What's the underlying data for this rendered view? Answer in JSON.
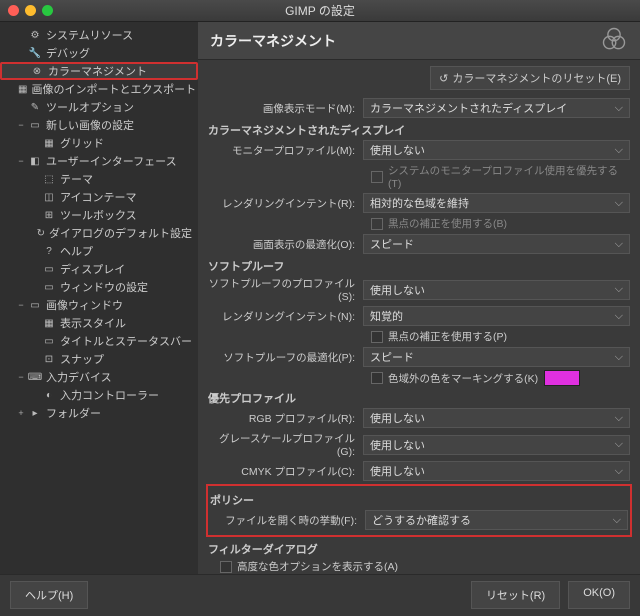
{
  "window": {
    "title": "GIMP の設定"
  },
  "sidebar": {
    "items": [
      {
        "label": "システムリソース",
        "depth": 1,
        "icon": "⚙"
      },
      {
        "label": "デバッグ",
        "depth": 1,
        "icon": "🔧"
      },
      {
        "label": "カラーマネジメント",
        "depth": 1,
        "icon": "⊗",
        "selected": true,
        "highlight": true
      },
      {
        "label": "画像のインポートとエクスポート",
        "depth": 1,
        "icon": "▦"
      },
      {
        "label": "ツールオプション",
        "depth": 1,
        "icon": "✎"
      },
      {
        "label": "新しい画像の設定",
        "depth": 1,
        "icon": "▭",
        "exp": "−"
      },
      {
        "label": "グリッド",
        "depth": 2,
        "icon": "▦"
      },
      {
        "label": "ユーザーインターフェース",
        "depth": 1,
        "icon": "◧",
        "exp": "−"
      },
      {
        "label": "テーマ",
        "depth": 2,
        "icon": "⬚"
      },
      {
        "label": "アイコンテーマ",
        "depth": 2,
        "icon": "◫"
      },
      {
        "label": "ツールボックス",
        "depth": 2,
        "icon": "⊞"
      },
      {
        "label": "ダイアログのデフォルト設定",
        "depth": 2,
        "icon": "↻"
      },
      {
        "label": "ヘルプ",
        "depth": 2,
        "icon": "?"
      },
      {
        "label": "ディスプレイ",
        "depth": 2,
        "icon": "▭"
      },
      {
        "label": "ウィンドウの設定",
        "depth": 2,
        "icon": "▭"
      },
      {
        "label": "画像ウィンドウ",
        "depth": 1,
        "icon": "▭",
        "exp": "−"
      },
      {
        "label": "表示スタイル",
        "depth": 2,
        "icon": "▦"
      },
      {
        "label": "タイトルとステータスバー",
        "depth": 2,
        "icon": "▭"
      },
      {
        "label": "スナップ",
        "depth": 2,
        "icon": "⊡"
      },
      {
        "label": "入力デバイス",
        "depth": 1,
        "icon": "⌨",
        "exp": "−"
      },
      {
        "label": "入力コントローラー",
        "depth": 2,
        "icon": "◐"
      },
      {
        "label": "フォルダー",
        "depth": 1,
        "icon": "▸",
        "exp": "+"
      }
    ]
  },
  "header": {
    "title": "カラーマネジメント"
  },
  "reset": {
    "label": "カラーマネジメントのリセット(E)"
  },
  "form": {
    "mode_lbl": "画像表示モード(M):",
    "mode_val": "カラーマネジメントされたディスプレイ",
    "grp_display": "カラーマネジメントされたディスプレイ",
    "monitor_lbl": "モニタープロファイル(M):",
    "monitor_val": "使用しない",
    "monitor_chk": "システムのモニタープロファイル使用を優先する(T)",
    "render1_lbl": "レンダリングインテント(R):",
    "render1_val": "相対的な色域を維持",
    "render1_chk": "黒点の補正を使用する(B)",
    "opt1_lbl": "画面表示の最適化(O):",
    "opt1_val": "スピード",
    "grp_soft": "ソフトプルーフ",
    "soft_lbl": "ソフトプルーフのプロファイル(S):",
    "soft_val": "使用しない",
    "render2_lbl": "レンダリングインテント(N):",
    "render2_val": "知覚的",
    "render2_chk": "黒点の補正を使用する(P)",
    "opt2_lbl": "ソフトプルーフの最適化(P):",
    "opt2_val": "スピード",
    "gamut_chk": "色域外の色をマーキングする(K)",
    "grp_pref": "優先プロファイル",
    "rgb_lbl": "RGB プロファイル(R):",
    "rgb_val": "使用しない",
    "gray_lbl": "グレースケールプロファイル(G):",
    "gray_val": "使用しない",
    "cmyk_lbl": "CMYK プロファイル(C):",
    "cmyk_val": "使用しない",
    "grp_policy": "ポリシー",
    "policy_lbl": "ファイルを開く時の挙動(F):",
    "policy_val": "どうするか確認する",
    "grp_filter": "フィルターダイアログ",
    "filter_chk": "高度な色オプションを表示する(A)"
  },
  "footer": {
    "help": "ヘルプ(H)",
    "reset": "リセット(R)",
    "ok": "OK(O)"
  }
}
